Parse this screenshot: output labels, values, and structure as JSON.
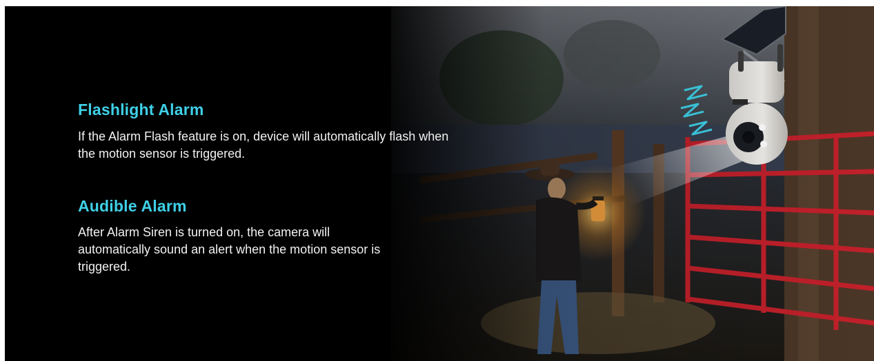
{
  "features": [
    {
      "title": "Flashlight Alarm",
      "description": "If the Alarm Flash feature is on, device will automatically flash when the motion sensor is triggered."
    },
    {
      "title": "Audible Alarm",
      "description": "After Alarm Siren is turned on, the camera will automatically sound an alert when the motion sensor is triggered."
    }
  ],
  "colors": {
    "background": "#000000",
    "heading": "#3fd0e8",
    "body_text": "#f2f2f2",
    "alert_bolts": "#3fd0e8",
    "gate": "#c0202a"
  }
}
